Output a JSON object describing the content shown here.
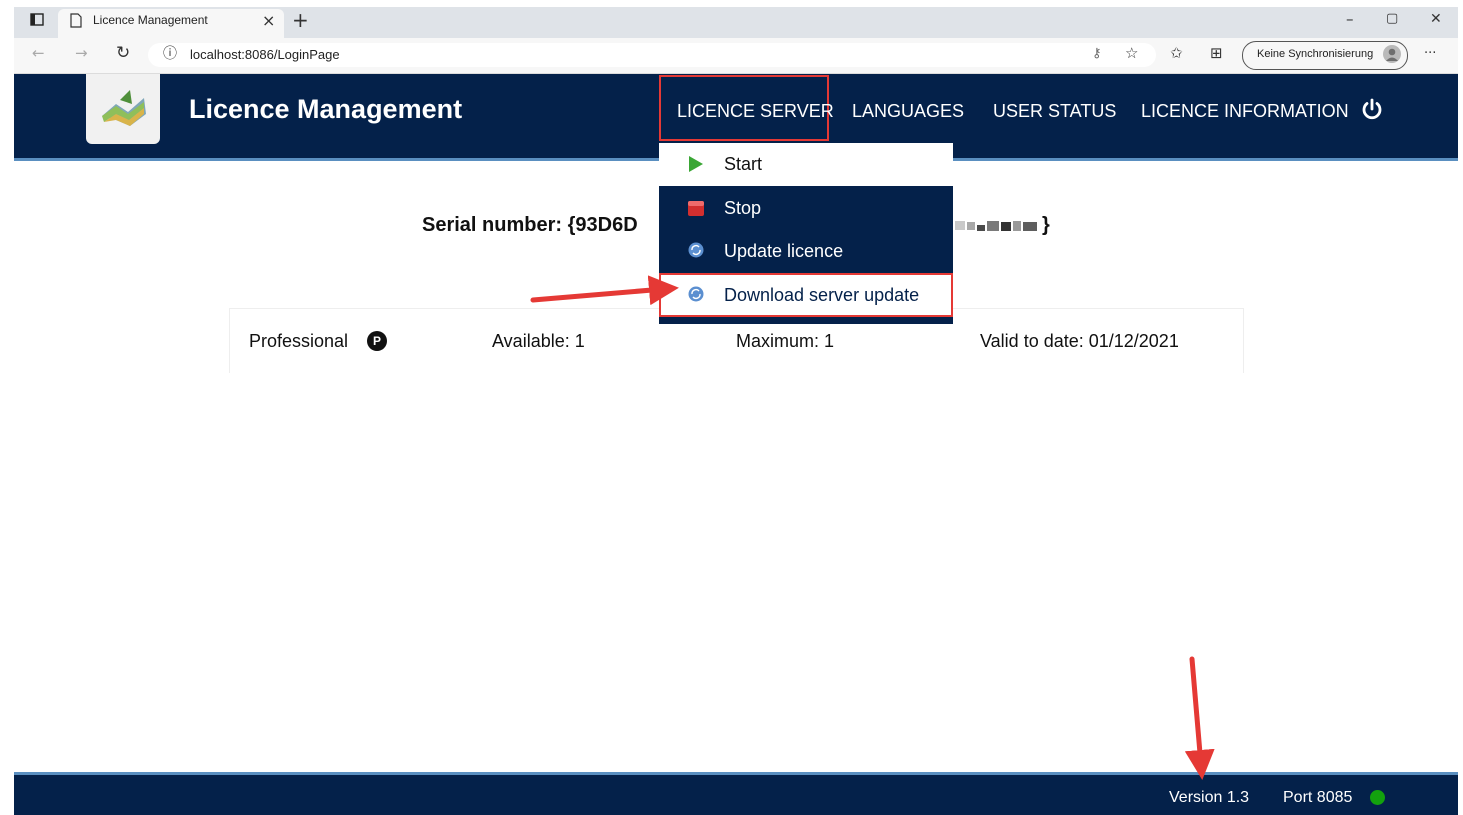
{
  "browser": {
    "tab_title": "Licence Management",
    "tab_close": "×",
    "new_tab": "+",
    "url_info_icon": "ⓘ",
    "url": "localhost:8086/LoginPage",
    "sync_label": "Keine Synchronisierung",
    "more": "···",
    "window_min": "–",
    "window_max": "▢",
    "window_close": "✕"
  },
  "header": {
    "title": "Licence Management",
    "nav": [
      "LICENCE SERVER",
      "LANGUAGES",
      "USER STATUS",
      "LICENCE INFORMATION"
    ],
    "power_icon": "power-icon"
  },
  "dropdown": {
    "items": [
      {
        "label": "Start",
        "icon": "play-icon"
      },
      {
        "label": "Stop",
        "icon": "stop-icon"
      },
      {
        "label": "Update licence",
        "icon": "sync-globe-icon"
      },
      {
        "label": "Download server update",
        "icon": "sync-globe-icon"
      }
    ]
  },
  "main": {
    "serial_label": "Serial number: {93D6D",
    "serial_end": "}",
    "licence": {
      "edition": "Professional",
      "edition_badge": "P",
      "available": "Available: 1",
      "maximum": "Maximum: 1",
      "valid_to": "Valid to date: 01/12/2021"
    }
  },
  "footer": {
    "version": "Version 1.3",
    "port": "Port 8085",
    "status_color": "#13a10e"
  },
  "colors": {
    "header_bg": "#04214a",
    "accent_border": "#5a8fc0",
    "highlight": "#e53935"
  }
}
